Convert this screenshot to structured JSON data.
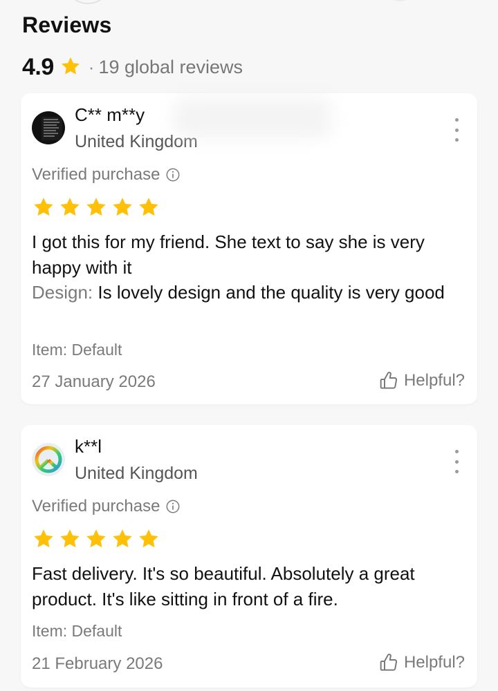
{
  "header": {
    "title": "Reviews",
    "rating": "4.9",
    "separator": "·",
    "review_count": "19 global reviews"
  },
  "colors": {
    "star": "#FFC107",
    "muted": "#7a7a7a"
  },
  "reviews": [
    {
      "name": "C** m**y",
      "country": "United Kingdom",
      "verified_label": "Verified purchase",
      "stars": 5,
      "text": "I got this for my friend. She text to say she is very happy with it",
      "design_label": "Design:",
      "design_text": " Is lovely design and the quality is very good",
      "item": "Item: Default",
      "date": "27 January 2026",
      "helpful": "Helpful?",
      "avatar_icon": "text-poster-avatar"
    },
    {
      "name": "k**l",
      "country": "United Kingdom",
      "verified_label": "Verified purchase",
      "stars": 5,
      "text": "Fast delivery. It's so beautiful. Absolutely a great product. It's like sitting in front of a fire.",
      "item": "Item: Default",
      "date": "21 February 2026",
      "helpful": "Helpful?",
      "avatar_icon": "peace-sign-avatar"
    }
  ]
}
